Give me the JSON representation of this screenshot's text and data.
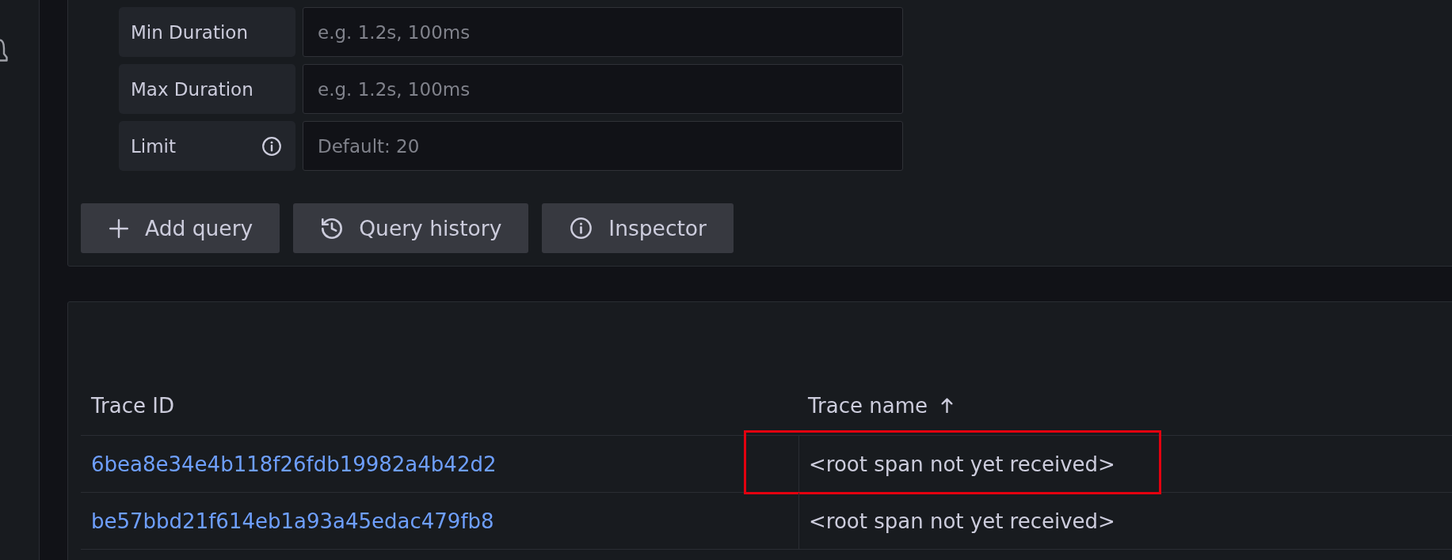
{
  "query_editor": {
    "fields": [
      {
        "label": "Min Duration",
        "placeholder": "e.g. 1.2s, 100ms",
        "info_tooltip": false
      },
      {
        "label": "Max Duration",
        "placeholder": "e.g. 1.2s, 100ms",
        "info_tooltip": false
      },
      {
        "label": "Limit",
        "placeholder": "Default: 20",
        "info_tooltip": true
      }
    ],
    "buttons": [
      {
        "kind": "add",
        "label": "Add query"
      },
      {
        "kind": "history",
        "label": "Query history"
      },
      {
        "kind": "inspector",
        "label": "Inspector"
      }
    ]
  },
  "table": {
    "columns": [
      {
        "label": "Trace ID",
        "sorted": false
      },
      {
        "label": "Trace name",
        "sorted": true
      }
    ],
    "rows": [
      {
        "trace_id": "6bea8e34e4b118f26fdb19982a4b42d2",
        "trace_name": "<root span not yet received>",
        "highlighted": true
      },
      {
        "trace_id": "be57bbd21f614eb1a93a45edac479fb8",
        "trace_name": "<root span not yet received>",
        "highlighted": false
      }
    ]
  }
}
